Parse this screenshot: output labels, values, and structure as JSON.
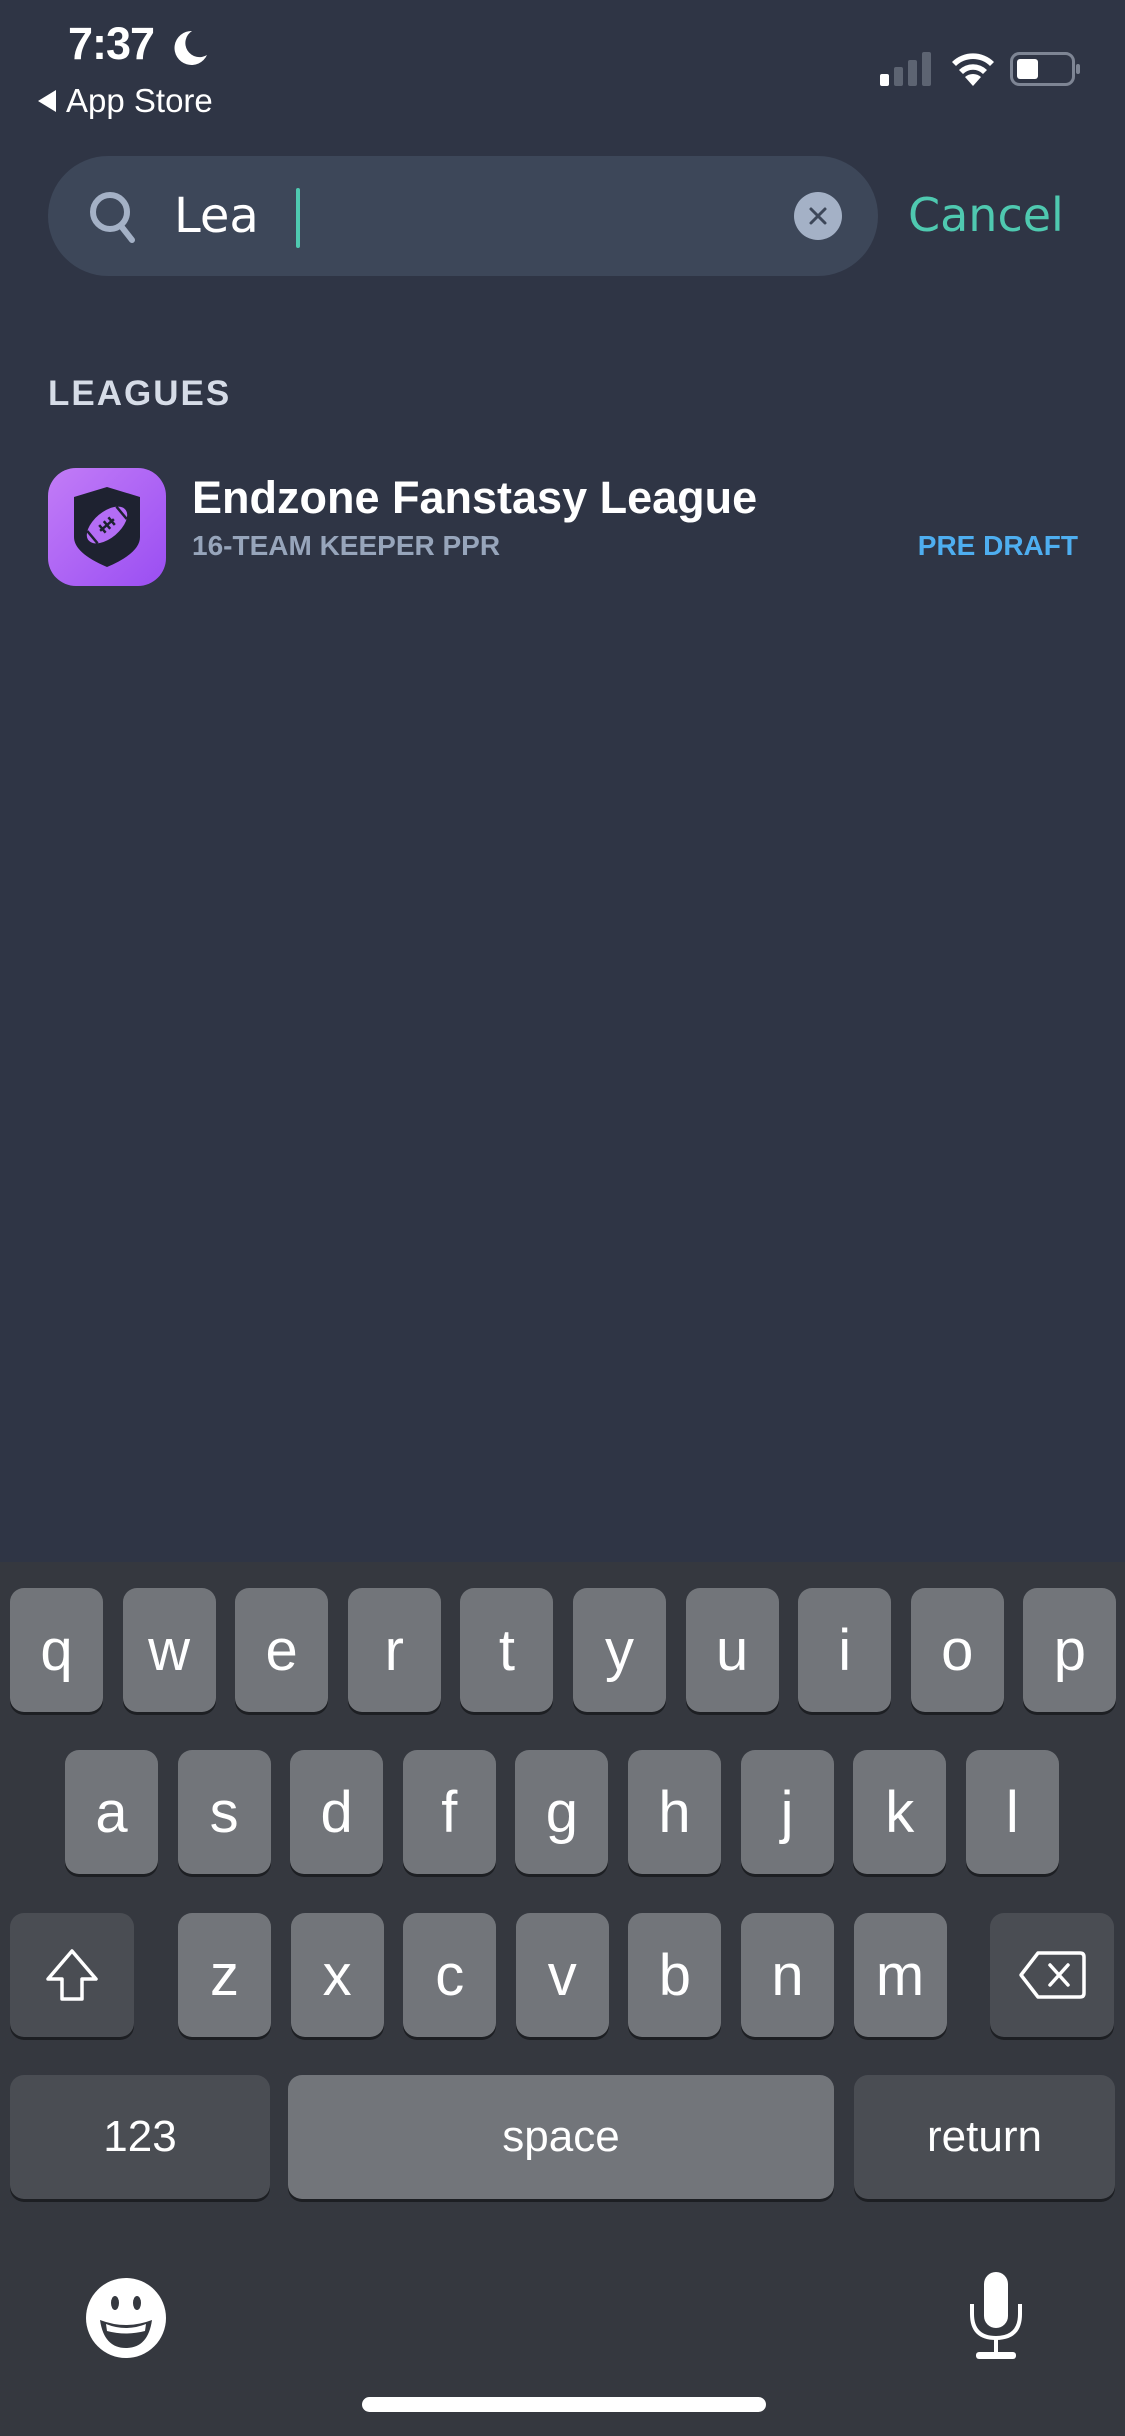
{
  "status_bar": {
    "time": "7:37",
    "back_label": "App Store",
    "icons": [
      "moon-icon",
      "cellular-signal-icon",
      "wifi-icon",
      "battery-icon"
    ]
  },
  "search": {
    "value": "Lea",
    "icon": "search-icon",
    "clear_icon": "clear-icon",
    "cancel_label": "Cancel"
  },
  "results": {
    "section_title": "LEAGUES",
    "items": [
      {
        "name": "Endzone Fanstasy League",
        "subtitle": "16-TEAM KEEPER PPR",
        "status": "PRE DRAFT",
        "icon": "football-shield-icon"
      }
    ]
  },
  "colors": {
    "accent": "#4fc9b0",
    "status_blue": "#4eaef0",
    "background": "#2f3545",
    "app_icon_purple": "#9a4ef2"
  },
  "keyboard": {
    "row1": [
      "q",
      "w",
      "e",
      "r",
      "t",
      "y",
      "u",
      "i",
      "o",
      "p"
    ],
    "row2": [
      "a",
      "s",
      "d",
      "f",
      "g",
      "h",
      "j",
      "k",
      "l"
    ],
    "row3": [
      "z",
      "x",
      "c",
      "v",
      "b",
      "n",
      "m"
    ],
    "numbers_label": "123",
    "space_label": "space",
    "return_label": "return",
    "icons": [
      "shift-icon",
      "backspace-icon",
      "emoji-icon",
      "microphone-icon"
    ]
  }
}
